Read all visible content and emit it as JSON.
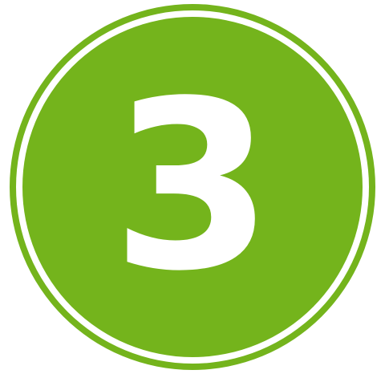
{
  "badge": {
    "number": "3",
    "colors": {
      "fill": "#74B41C",
      "ring_gap": "#FFFFFF",
      "number": "#FFFFFF",
      "background": "#FFFFFF"
    }
  }
}
